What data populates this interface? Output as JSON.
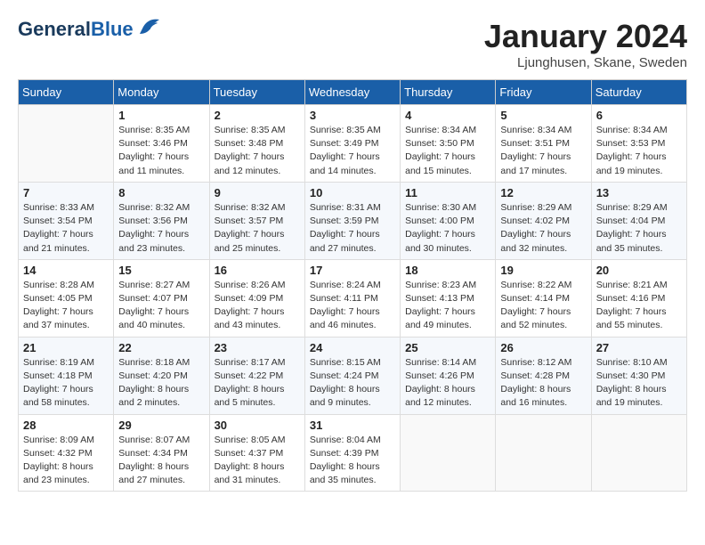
{
  "header": {
    "logo_general": "General",
    "logo_blue": "Blue",
    "title": "January 2024",
    "location": "Ljunghusen, Skane, Sweden"
  },
  "days_of_week": [
    "Sunday",
    "Monday",
    "Tuesday",
    "Wednesday",
    "Thursday",
    "Friday",
    "Saturday"
  ],
  "weeks": [
    [
      {
        "day": "",
        "sunrise": "",
        "sunset": "",
        "daylight": ""
      },
      {
        "day": "1",
        "sunrise": "Sunrise: 8:35 AM",
        "sunset": "Sunset: 3:46 PM",
        "daylight": "Daylight: 7 hours and 11 minutes."
      },
      {
        "day": "2",
        "sunrise": "Sunrise: 8:35 AM",
        "sunset": "Sunset: 3:48 PM",
        "daylight": "Daylight: 7 hours and 12 minutes."
      },
      {
        "day": "3",
        "sunrise": "Sunrise: 8:35 AM",
        "sunset": "Sunset: 3:49 PM",
        "daylight": "Daylight: 7 hours and 14 minutes."
      },
      {
        "day": "4",
        "sunrise": "Sunrise: 8:34 AM",
        "sunset": "Sunset: 3:50 PM",
        "daylight": "Daylight: 7 hours and 15 minutes."
      },
      {
        "day": "5",
        "sunrise": "Sunrise: 8:34 AM",
        "sunset": "Sunset: 3:51 PM",
        "daylight": "Daylight: 7 hours and 17 minutes."
      },
      {
        "day": "6",
        "sunrise": "Sunrise: 8:34 AM",
        "sunset": "Sunset: 3:53 PM",
        "daylight": "Daylight: 7 hours and 19 minutes."
      }
    ],
    [
      {
        "day": "7",
        "sunrise": "Sunrise: 8:33 AM",
        "sunset": "Sunset: 3:54 PM",
        "daylight": "Daylight: 7 hours and 21 minutes."
      },
      {
        "day": "8",
        "sunrise": "Sunrise: 8:32 AM",
        "sunset": "Sunset: 3:56 PM",
        "daylight": "Daylight: 7 hours and 23 minutes."
      },
      {
        "day": "9",
        "sunrise": "Sunrise: 8:32 AM",
        "sunset": "Sunset: 3:57 PM",
        "daylight": "Daylight: 7 hours and 25 minutes."
      },
      {
        "day": "10",
        "sunrise": "Sunrise: 8:31 AM",
        "sunset": "Sunset: 3:59 PM",
        "daylight": "Daylight: 7 hours and 27 minutes."
      },
      {
        "day": "11",
        "sunrise": "Sunrise: 8:30 AM",
        "sunset": "Sunset: 4:00 PM",
        "daylight": "Daylight: 7 hours and 30 minutes."
      },
      {
        "day": "12",
        "sunrise": "Sunrise: 8:29 AM",
        "sunset": "Sunset: 4:02 PM",
        "daylight": "Daylight: 7 hours and 32 minutes."
      },
      {
        "day": "13",
        "sunrise": "Sunrise: 8:29 AM",
        "sunset": "Sunset: 4:04 PM",
        "daylight": "Daylight: 7 hours and 35 minutes."
      }
    ],
    [
      {
        "day": "14",
        "sunrise": "Sunrise: 8:28 AM",
        "sunset": "Sunset: 4:05 PM",
        "daylight": "Daylight: 7 hours and 37 minutes."
      },
      {
        "day": "15",
        "sunrise": "Sunrise: 8:27 AM",
        "sunset": "Sunset: 4:07 PM",
        "daylight": "Daylight: 7 hours and 40 minutes."
      },
      {
        "day": "16",
        "sunrise": "Sunrise: 8:26 AM",
        "sunset": "Sunset: 4:09 PM",
        "daylight": "Daylight: 7 hours and 43 minutes."
      },
      {
        "day": "17",
        "sunrise": "Sunrise: 8:24 AM",
        "sunset": "Sunset: 4:11 PM",
        "daylight": "Daylight: 7 hours and 46 minutes."
      },
      {
        "day": "18",
        "sunrise": "Sunrise: 8:23 AM",
        "sunset": "Sunset: 4:13 PM",
        "daylight": "Daylight: 7 hours and 49 minutes."
      },
      {
        "day": "19",
        "sunrise": "Sunrise: 8:22 AM",
        "sunset": "Sunset: 4:14 PM",
        "daylight": "Daylight: 7 hours and 52 minutes."
      },
      {
        "day": "20",
        "sunrise": "Sunrise: 8:21 AM",
        "sunset": "Sunset: 4:16 PM",
        "daylight": "Daylight: 7 hours and 55 minutes."
      }
    ],
    [
      {
        "day": "21",
        "sunrise": "Sunrise: 8:19 AM",
        "sunset": "Sunset: 4:18 PM",
        "daylight": "Daylight: 7 hours and 58 minutes."
      },
      {
        "day": "22",
        "sunrise": "Sunrise: 8:18 AM",
        "sunset": "Sunset: 4:20 PM",
        "daylight": "Daylight: 8 hours and 2 minutes."
      },
      {
        "day": "23",
        "sunrise": "Sunrise: 8:17 AM",
        "sunset": "Sunset: 4:22 PM",
        "daylight": "Daylight: 8 hours and 5 minutes."
      },
      {
        "day": "24",
        "sunrise": "Sunrise: 8:15 AM",
        "sunset": "Sunset: 4:24 PM",
        "daylight": "Daylight: 8 hours and 9 minutes."
      },
      {
        "day": "25",
        "sunrise": "Sunrise: 8:14 AM",
        "sunset": "Sunset: 4:26 PM",
        "daylight": "Daylight: 8 hours and 12 minutes."
      },
      {
        "day": "26",
        "sunrise": "Sunrise: 8:12 AM",
        "sunset": "Sunset: 4:28 PM",
        "daylight": "Daylight: 8 hours and 16 minutes."
      },
      {
        "day": "27",
        "sunrise": "Sunrise: 8:10 AM",
        "sunset": "Sunset: 4:30 PM",
        "daylight": "Daylight: 8 hours and 19 minutes."
      }
    ],
    [
      {
        "day": "28",
        "sunrise": "Sunrise: 8:09 AM",
        "sunset": "Sunset: 4:32 PM",
        "daylight": "Daylight: 8 hours and 23 minutes."
      },
      {
        "day": "29",
        "sunrise": "Sunrise: 8:07 AM",
        "sunset": "Sunset: 4:34 PM",
        "daylight": "Daylight: 8 hours and 27 minutes."
      },
      {
        "day": "30",
        "sunrise": "Sunrise: 8:05 AM",
        "sunset": "Sunset: 4:37 PM",
        "daylight": "Daylight: 8 hours and 31 minutes."
      },
      {
        "day": "31",
        "sunrise": "Sunrise: 8:04 AM",
        "sunset": "Sunset: 4:39 PM",
        "daylight": "Daylight: 8 hours and 35 minutes."
      },
      {
        "day": "",
        "sunrise": "",
        "sunset": "",
        "daylight": ""
      },
      {
        "day": "",
        "sunrise": "",
        "sunset": "",
        "daylight": ""
      },
      {
        "day": "",
        "sunrise": "",
        "sunset": "",
        "daylight": ""
      }
    ]
  ]
}
